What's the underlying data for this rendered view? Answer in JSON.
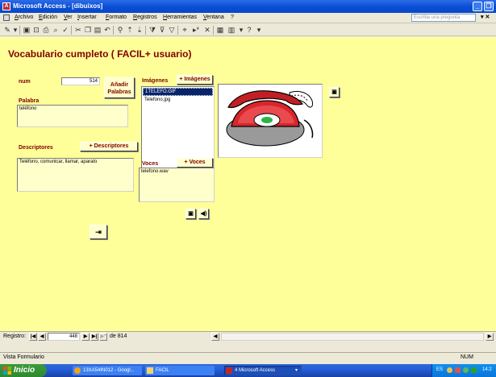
{
  "window": {
    "title": "Microsoft Access - [dibuixos]",
    "app_icon_letter": "A"
  },
  "menu": {
    "items": [
      "Archivo",
      "Edición",
      "Ver",
      "Insertar",
      "Formato",
      "Registros",
      "Herramientas",
      "Ventana",
      "?"
    ],
    "ask_placeholder": "Escriba una pregunta"
  },
  "form": {
    "title": "Vocabulario cumpleto ( FACIL+ usuario)",
    "num_label": "num",
    "num_value": "514",
    "add_words_button": "Añadir Palabras",
    "word_label": "Palabra",
    "word_value": "teléfono",
    "descriptors_label": "Descriptores",
    "add_descriptors_button": "+ Descriptores",
    "descriptors_value": "Teléfono, comunicar, llamar, aparato",
    "images_label": "Imágenes",
    "add_images_button": "+ Imágenes",
    "images_list": [
      {
        "name": "1TELEFO.GIF",
        "selected": true
      },
      {
        "name": "Telefono.jpg",
        "selected": false
      }
    ],
    "voices_label": "Voces",
    "add_voices_button": "+ Voces",
    "voices_list": [
      "telefono.wav"
    ]
  },
  "record_nav": {
    "label": "Registro:",
    "current": "448",
    "of_label": "de 814"
  },
  "status": {
    "left": "Vista Formulario",
    "right": "NUM"
  },
  "taskbar": {
    "start_label": "Inicio",
    "tasks": [
      {
        "label": "13XA54IN012 - Googl..."
      },
      {
        "label": "FACIL"
      },
      {
        "label": "4 Microsoft Access"
      }
    ],
    "tray_lang": "ES",
    "tray_time": "14:2"
  },
  "colors": {
    "form_bg": "#ffff99",
    "label_color": "#800000",
    "title_bar": "#0a4ed6",
    "taskbar": "#245edb",
    "start_button": "#3c9a3c"
  }
}
